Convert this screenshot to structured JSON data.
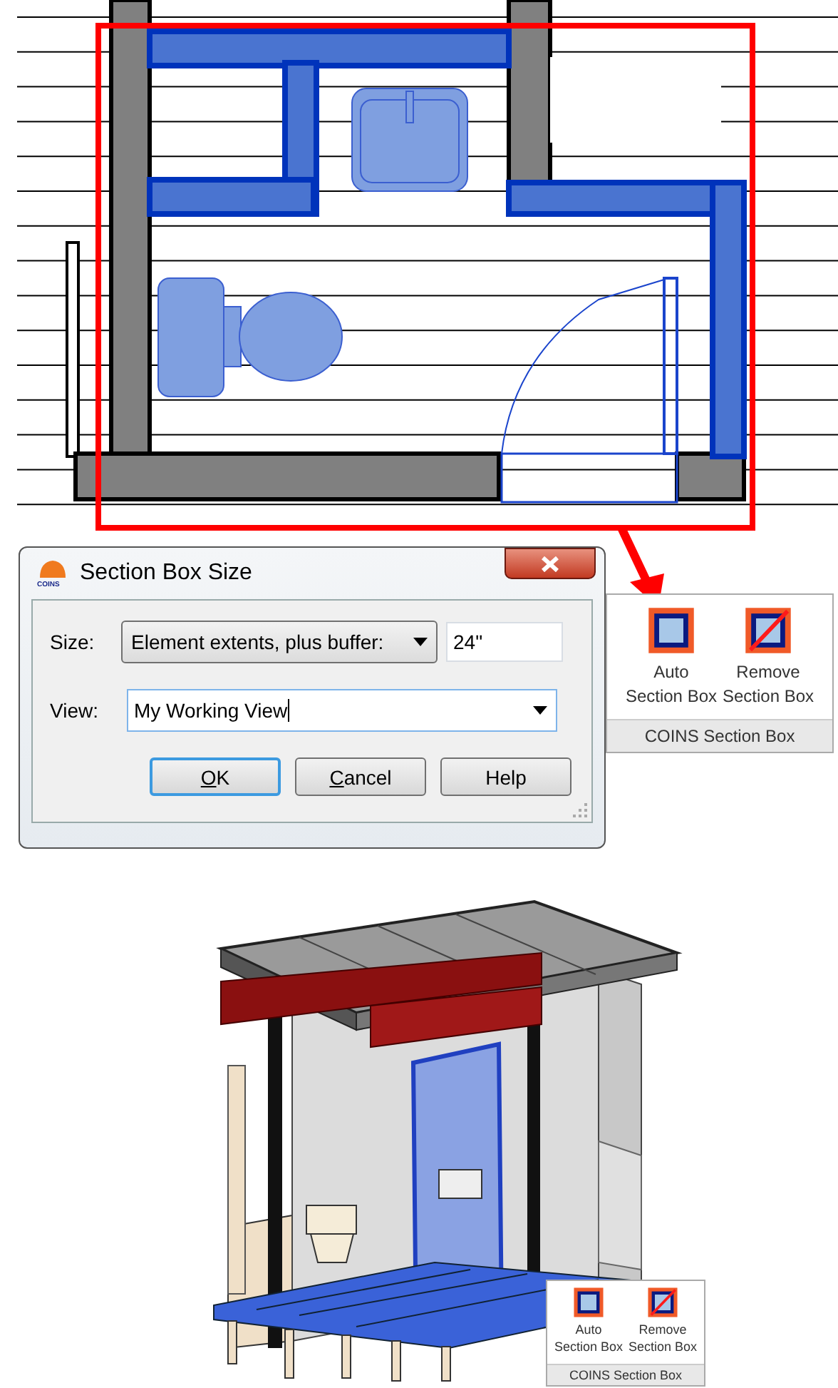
{
  "dialog": {
    "title": "Section Box Size",
    "logo_text": "COINS",
    "size_label": "Size:",
    "size_option": "Element extents, plus buffer:",
    "buffer_value": "24\"",
    "view_label": "View:",
    "view_value": "My Working View",
    "buttons": [
      {
        "label": "OK",
        "default": true,
        "underline_first": true
      },
      {
        "label": "Cancel",
        "default": false,
        "underline_first": true
      },
      {
        "label": "Help",
        "default": false,
        "underline_first": false
      }
    ]
  },
  "ribbon_panel": {
    "buttons": [
      {
        "kind": "auto",
        "lines": [
          "Auto",
          "Section Box"
        ]
      },
      {
        "kind": "remove",
        "lines": [
          "Remove",
          "Section Box"
        ]
      }
    ],
    "title": "COINS Section Box"
  },
  "ribbon_panel_inset": {
    "buttons": [
      {
        "kind": "auto",
        "lines": [
          "Auto",
          "Section Box"
        ]
      },
      {
        "kind": "remove",
        "lines": [
          "Remove",
          "Section Box"
        ]
      }
    ],
    "title": "COINS Section Box"
  }
}
